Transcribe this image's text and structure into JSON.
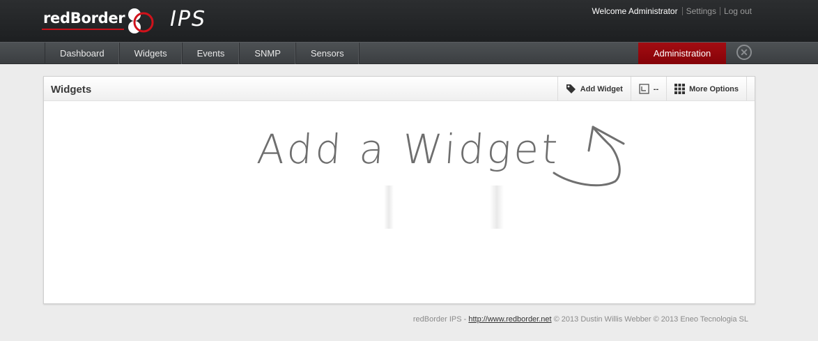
{
  "header": {
    "logo_text": "redBorder",
    "product_name": "IPS",
    "welcome_text": "Welcome Administrator",
    "settings_label": "Settings",
    "logout_label": "Log out"
  },
  "nav": {
    "items": [
      "Dashboard",
      "Widgets",
      "Events",
      "SNMP",
      "Sensors"
    ],
    "admin_label": "Administration",
    "close_icon": "close-circle-icon",
    "active_color": "#970a0f"
  },
  "panel": {
    "title": "Widgets",
    "actions": {
      "add_widget_label": "Add Widget",
      "add_widget_icon": "tag-icon",
      "layout_label": "--",
      "layout_icon": "layout-icon",
      "more_options_label": "More Options",
      "more_options_icon": "grid-icon"
    },
    "hint_text": "Add a Widget",
    "hint_icon": "curved-arrow-up-icon"
  },
  "footer": {
    "prefix": "redBorder IPS - ",
    "url": "http://www.redborder.net",
    "suffix": " © 2013 Dustin Willis Webber © 2013 Eneo Tecnologia SL"
  }
}
